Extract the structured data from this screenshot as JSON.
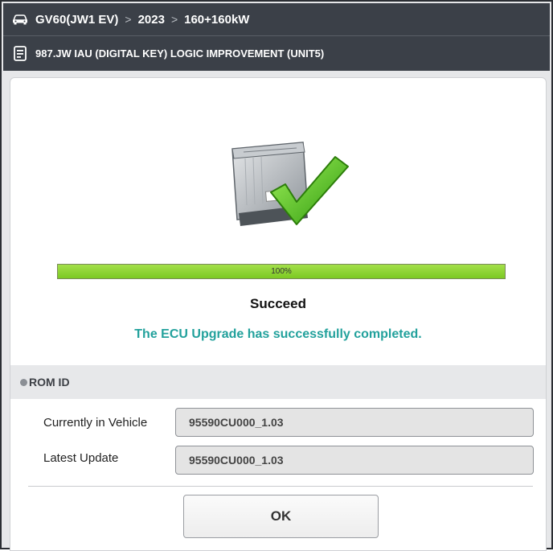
{
  "header": {
    "breadcrumb": [
      "GV60(JW1 EV)",
      "2023",
      "160+160kW"
    ],
    "breadcrumb_separator": ">",
    "vehicle_icon": "car-icon",
    "document_icon": "document-icon",
    "subtitle": "987.JW IAU (DIGITAL KEY) LOGIC IMPROVEMENT (UNIT5)"
  },
  "dialog": {
    "illustration_icon": "ecu-check-icon",
    "progress": {
      "value": 100,
      "label": "100%"
    },
    "status_title": "Succeed",
    "status_message": "The ECU Upgrade has successfully completed.",
    "section_title": "ROM ID",
    "fields": [
      {
        "label": "Currently in Vehicle",
        "value": "95590CU000_1.03"
      },
      {
        "label": "Latest Update",
        "value": "95590CU000_1.03"
      }
    ],
    "ok_label": "OK"
  },
  "colors": {
    "header_bg": "#3b4048",
    "progress_fill": "#8bd12d",
    "message_teal": "#22a19c",
    "check_green": "#58c21a"
  }
}
